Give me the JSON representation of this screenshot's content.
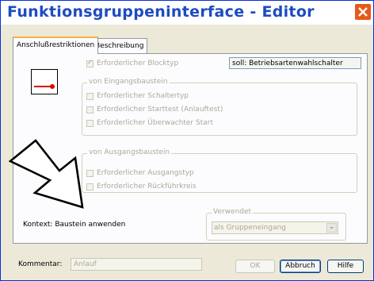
{
  "window": {
    "title": "Funktionsgruppeninterface - Editor"
  },
  "tabs": [
    {
      "label": "Anschlußrestriktionen",
      "active": true
    },
    {
      "label": "Beschreibung",
      "active": false
    }
  ],
  "blocktyp": {
    "label": "Erforderlicher Blocktyp",
    "checked": true,
    "soll_text": "soll: Betriebsartenwahlschalter"
  },
  "eingang": {
    "legend": "von Eingangsbaustein",
    "items": [
      {
        "label": "Erforderlicher Schaltertyp",
        "checked": false
      },
      {
        "label": "Erforderlicher Starttest (Anlauftest)",
        "checked": false
      },
      {
        "label": "Erforderlicher Überwachter Start",
        "checked": false
      }
    ]
  },
  "ausgang": {
    "legend": "von Ausgangsbaustein",
    "items": [
      {
        "label": "Erforderlicher Ausgangstyp",
        "checked": false
      },
      {
        "label": "Erforderlicher Rückführkreis",
        "checked": false
      }
    ]
  },
  "kontext": {
    "label": "Kontext: Baustein anwenden"
  },
  "verwendet": {
    "legend": "Verwendet",
    "selected": "als Gruppeneingang"
  },
  "kommentar": {
    "label": "Kommentar:",
    "value": "Anlauf"
  },
  "buttons": {
    "ok": "OK",
    "abbruch": "Abbruch",
    "hilfe": "Hilfe"
  },
  "colors": {
    "title_text": "#1e4bc3",
    "close_button": "#e5591a",
    "icon_red": "#e00000",
    "dialog_bg": "#ece9d8",
    "tab_highlight": "#f9b13a"
  }
}
